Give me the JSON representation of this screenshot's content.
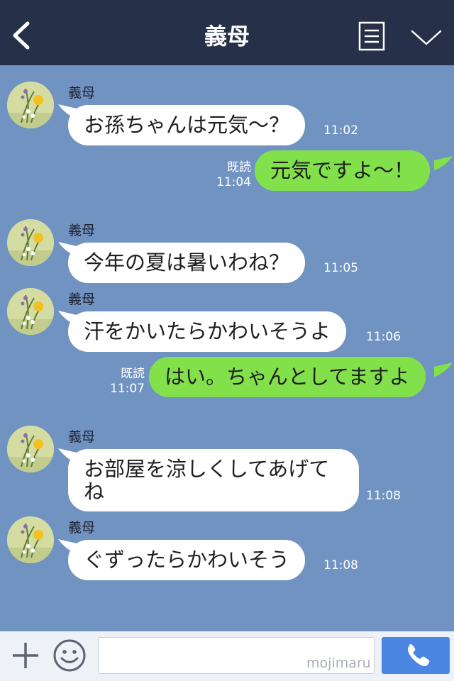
{
  "header": {
    "title": "義母",
    "back_icon": "chevron-left-icon",
    "menu_icon": "note-list-icon",
    "expand_icon": "chevron-down-icon"
  },
  "messages": [
    {
      "side": "in",
      "sender": "義母",
      "text": "お孫ちゃんは元気〜？",
      "time": "11:02"
    },
    {
      "side": "out",
      "text": "元気ですよ〜！",
      "read": "既読",
      "time": "11:04"
    },
    {
      "side": "in",
      "sender": "義母",
      "text": "今年の夏は暑いわね？",
      "time": "11:05"
    },
    {
      "side": "in",
      "sender": "義母",
      "text": "汗をかいたらかわいそうよ",
      "time": "11:06"
    },
    {
      "side": "out",
      "text": "はい。ちゃんとしてますよ",
      "read": "既読",
      "time": "11:07"
    },
    {
      "side": "in",
      "sender": "義母",
      "text": "お部屋を涼しくしてあげて\nね",
      "time": "11:08"
    },
    {
      "side": "in",
      "sender": "義母",
      "text": "ぐずったらかわいそう",
      "time": "11:08"
    }
  ],
  "footer": {
    "plus_icon": "plus-icon",
    "emoji_icon": "smiley-icon",
    "input_value": "",
    "watermark": "mojimaru",
    "call_icon": "phone-icon"
  },
  "colors": {
    "header_bg": "#263049",
    "chat_bg": "#7193c2",
    "incoming_bubble": "#ffffff",
    "outgoing_bubble": "#82e14b",
    "call_button": "#4a86e2"
  }
}
